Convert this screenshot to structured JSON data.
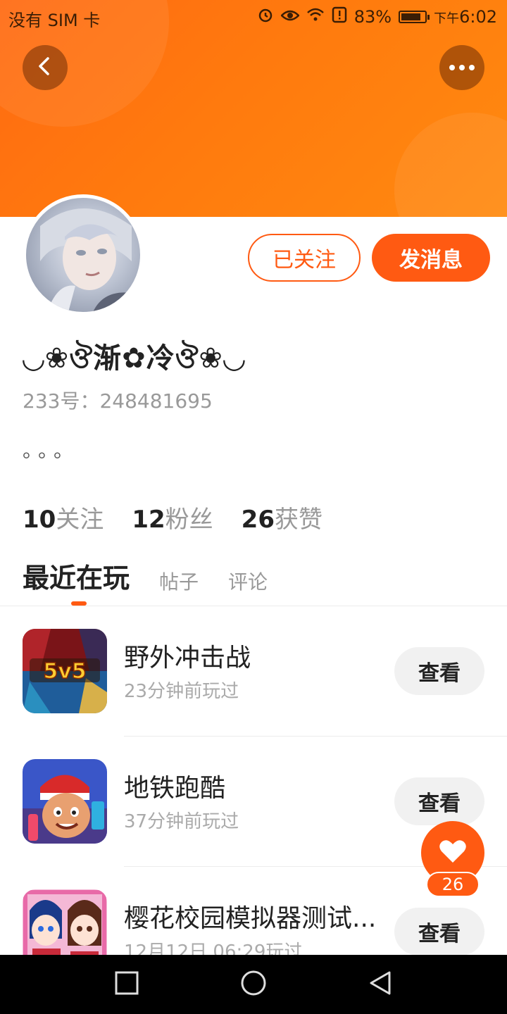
{
  "status_bar": {
    "carrier": "没有 SIM 卡",
    "battery_percent": "83%",
    "battery_level": 0.83,
    "time_prefix": "下午",
    "time": "6:02",
    "icons": [
      "alarm-icon",
      "eye-icon",
      "wifi-icon",
      "alert-icon",
      "battery-icon"
    ]
  },
  "header": {
    "back_icon": "chevron-left-icon",
    "more_icon": "more-horizontal-icon"
  },
  "profile": {
    "username": "◡❀ঔ渐✿冷ঔ❀◡",
    "id_label": "233号：248481695",
    "bio": "。。。",
    "follow_button": "已关注",
    "message_button": "发消息"
  },
  "stats": [
    {
      "value": "10",
      "label": "关注"
    },
    {
      "value": "12",
      "label": "粉丝"
    },
    {
      "value": "26",
      "label": "获赞"
    }
  ],
  "tabs": [
    {
      "label": "最近在玩",
      "active": true
    },
    {
      "label": "帖子",
      "active": false
    },
    {
      "label": "评论",
      "active": false
    }
  ],
  "games": [
    {
      "title": "野外冲击战",
      "time": "23分钟前玩过",
      "button": "查看",
      "icon_text": "5v5"
    },
    {
      "title": "地铁跑酷",
      "time": "37分钟前玩过",
      "button": "查看",
      "icon_text": ""
    },
    {
      "title": "樱花校园模拟器测试...",
      "time": "12月12日 06:29玩过",
      "button": "查看",
      "icon_text": ""
    }
  ],
  "like_fab": {
    "icon": "heart-icon",
    "count": "26"
  },
  "colors": {
    "accent": "#ff5a12",
    "header_gradient_start": "#ff6a12",
    "header_gradient_end": "#ff8a10"
  },
  "nav_bar": {
    "icons": [
      "recent-apps-icon",
      "home-icon",
      "back-triangle-icon"
    ]
  }
}
